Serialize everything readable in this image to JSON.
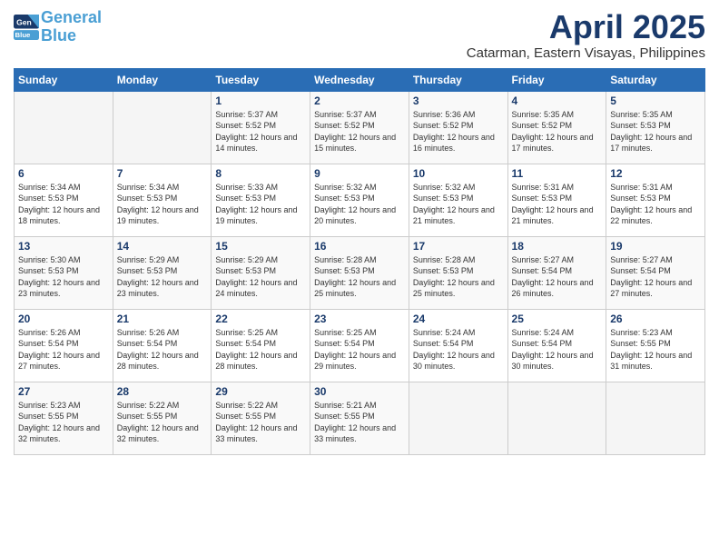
{
  "logo": {
    "line1": "General",
    "line2": "Blue"
  },
  "title": "April 2025",
  "subtitle": "Catarman, Eastern Visayas, Philippines",
  "days_of_week": [
    "Sunday",
    "Monday",
    "Tuesday",
    "Wednesday",
    "Thursday",
    "Friday",
    "Saturday"
  ],
  "weeks": [
    [
      {
        "num": "",
        "sunrise": "",
        "sunset": "",
        "daylight": ""
      },
      {
        "num": "",
        "sunrise": "",
        "sunset": "",
        "daylight": ""
      },
      {
        "num": "1",
        "sunrise": "Sunrise: 5:37 AM",
        "sunset": "Sunset: 5:52 PM",
        "daylight": "Daylight: 12 hours and 14 minutes."
      },
      {
        "num": "2",
        "sunrise": "Sunrise: 5:37 AM",
        "sunset": "Sunset: 5:52 PM",
        "daylight": "Daylight: 12 hours and 15 minutes."
      },
      {
        "num": "3",
        "sunrise": "Sunrise: 5:36 AM",
        "sunset": "Sunset: 5:52 PM",
        "daylight": "Daylight: 12 hours and 16 minutes."
      },
      {
        "num": "4",
        "sunrise": "Sunrise: 5:35 AM",
        "sunset": "Sunset: 5:52 PM",
        "daylight": "Daylight: 12 hours and 17 minutes."
      },
      {
        "num": "5",
        "sunrise": "Sunrise: 5:35 AM",
        "sunset": "Sunset: 5:53 PM",
        "daylight": "Daylight: 12 hours and 17 minutes."
      }
    ],
    [
      {
        "num": "6",
        "sunrise": "Sunrise: 5:34 AM",
        "sunset": "Sunset: 5:53 PM",
        "daylight": "Daylight: 12 hours and 18 minutes."
      },
      {
        "num": "7",
        "sunrise": "Sunrise: 5:34 AM",
        "sunset": "Sunset: 5:53 PM",
        "daylight": "Daylight: 12 hours and 19 minutes."
      },
      {
        "num": "8",
        "sunrise": "Sunrise: 5:33 AM",
        "sunset": "Sunset: 5:53 PM",
        "daylight": "Daylight: 12 hours and 19 minutes."
      },
      {
        "num": "9",
        "sunrise": "Sunrise: 5:32 AM",
        "sunset": "Sunset: 5:53 PM",
        "daylight": "Daylight: 12 hours and 20 minutes."
      },
      {
        "num": "10",
        "sunrise": "Sunrise: 5:32 AM",
        "sunset": "Sunset: 5:53 PM",
        "daylight": "Daylight: 12 hours and 21 minutes."
      },
      {
        "num": "11",
        "sunrise": "Sunrise: 5:31 AM",
        "sunset": "Sunset: 5:53 PM",
        "daylight": "Daylight: 12 hours and 21 minutes."
      },
      {
        "num": "12",
        "sunrise": "Sunrise: 5:31 AM",
        "sunset": "Sunset: 5:53 PM",
        "daylight": "Daylight: 12 hours and 22 minutes."
      }
    ],
    [
      {
        "num": "13",
        "sunrise": "Sunrise: 5:30 AM",
        "sunset": "Sunset: 5:53 PM",
        "daylight": "Daylight: 12 hours and 23 minutes."
      },
      {
        "num": "14",
        "sunrise": "Sunrise: 5:29 AM",
        "sunset": "Sunset: 5:53 PM",
        "daylight": "Daylight: 12 hours and 23 minutes."
      },
      {
        "num": "15",
        "sunrise": "Sunrise: 5:29 AM",
        "sunset": "Sunset: 5:53 PM",
        "daylight": "Daylight: 12 hours and 24 minutes."
      },
      {
        "num": "16",
        "sunrise": "Sunrise: 5:28 AM",
        "sunset": "Sunset: 5:53 PM",
        "daylight": "Daylight: 12 hours and 25 minutes."
      },
      {
        "num": "17",
        "sunrise": "Sunrise: 5:28 AM",
        "sunset": "Sunset: 5:53 PM",
        "daylight": "Daylight: 12 hours and 25 minutes."
      },
      {
        "num": "18",
        "sunrise": "Sunrise: 5:27 AM",
        "sunset": "Sunset: 5:54 PM",
        "daylight": "Daylight: 12 hours and 26 minutes."
      },
      {
        "num": "19",
        "sunrise": "Sunrise: 5:27 AM",
        "sunset": "Sunset: 5:54 PM",
        "daylight": "Daylight: 12 hours and 27 minutes."
      }
    ],
    [
      {
        "num": "20",
        "sunrise": "Sunrise: 5:26 AM",
        "sunset": "Sunset: 5:54 PM",
        "daylight": "Daylight: 12 hours and 27 minutes."
      },
      {
        "num": "21",
        "sunrise": "Sunrise: 5:26 AM",
        "sunset": "Sunset: 5:54 PM",
        "daylight": "Daylight: 12 hours and 28 minutes."
      },
      {
        "num": "22",
        "sunrise": "Sunrise: 5:25 AM",
        "sunset": "Sunset: 5:54 PM",
        "daylight": "Daylight: 12 hours and 28 minutes."
      },
      {
        "num": "23",
        "sunrise": "Sunrise: 5:25 AM",
        "sunset": "Sunset: 5:54 PM",
        "daylight": "Daylight: 12 hours and 29 minutes."
      },
      {
        "num": "24",
        "sunrise": "Sunrise: 5:24 AM",
        "sunset": "Sunset: 5:54 PM",
        "daylight": "Daylight: 12 hours and 30 minutes."
      },
      {
        "num": "25",
        "sunrise": "Sunrise: 5:24 AM",
        "sunset": "Sunset: 5:54 PM",
        "daylight": "Daylight: 12 hours and 30 minutes."
      },
      {
        "num": "26",
        "sunrise": "Sunrise: 5:23 AM",
        "sunset": "Sunset: 5:55 PM",
        "daylight": "Daylight: 12 hours and 31 minutes."
      }
    ],
    [
      {
        "num": "27",
        "sunrise": "Sunrise: 5:23 AM",
        "sunset": "Sunset: 5:55 PM",
        "daylight": "Daylight: 12 hours and 32 minutes."
      },
      {
        "num": "28",
        "sunrise": "Sunrise: 5:22 AM",
        "sunset": "Sunset: 5:55 PM",
        "daylight": "Daylight: 12 hours and 32 minutes."
      },
      {
        "num": "29",
        "sunrise": "Sunrise: 5:22 AM",
        "sunset": "Sunset: 5:55 PM",
        "daylight": "Daylight: 12 hours and 33 minutes."
      },
      {
        "num": "30",
        "sunrise": "Sunrise: 5:21 AM",
        "sunset": "Sunset: 5:55 PM",
        "daylight": "Daylight: 12 hours and 33 minutes."
      },
      {
        "num": "",
        "sunrise": "",
        "sunset": "",
        "daylight": ""
      },
      {
        "num": "",
        "sunrise": "",
        "sunset": "",
        "daylight": ""
      },
      {
        "num": "",
        "sunrise": "",
        "sunset": "",
        "daylight": ""
      }
    ]
  ]
}
